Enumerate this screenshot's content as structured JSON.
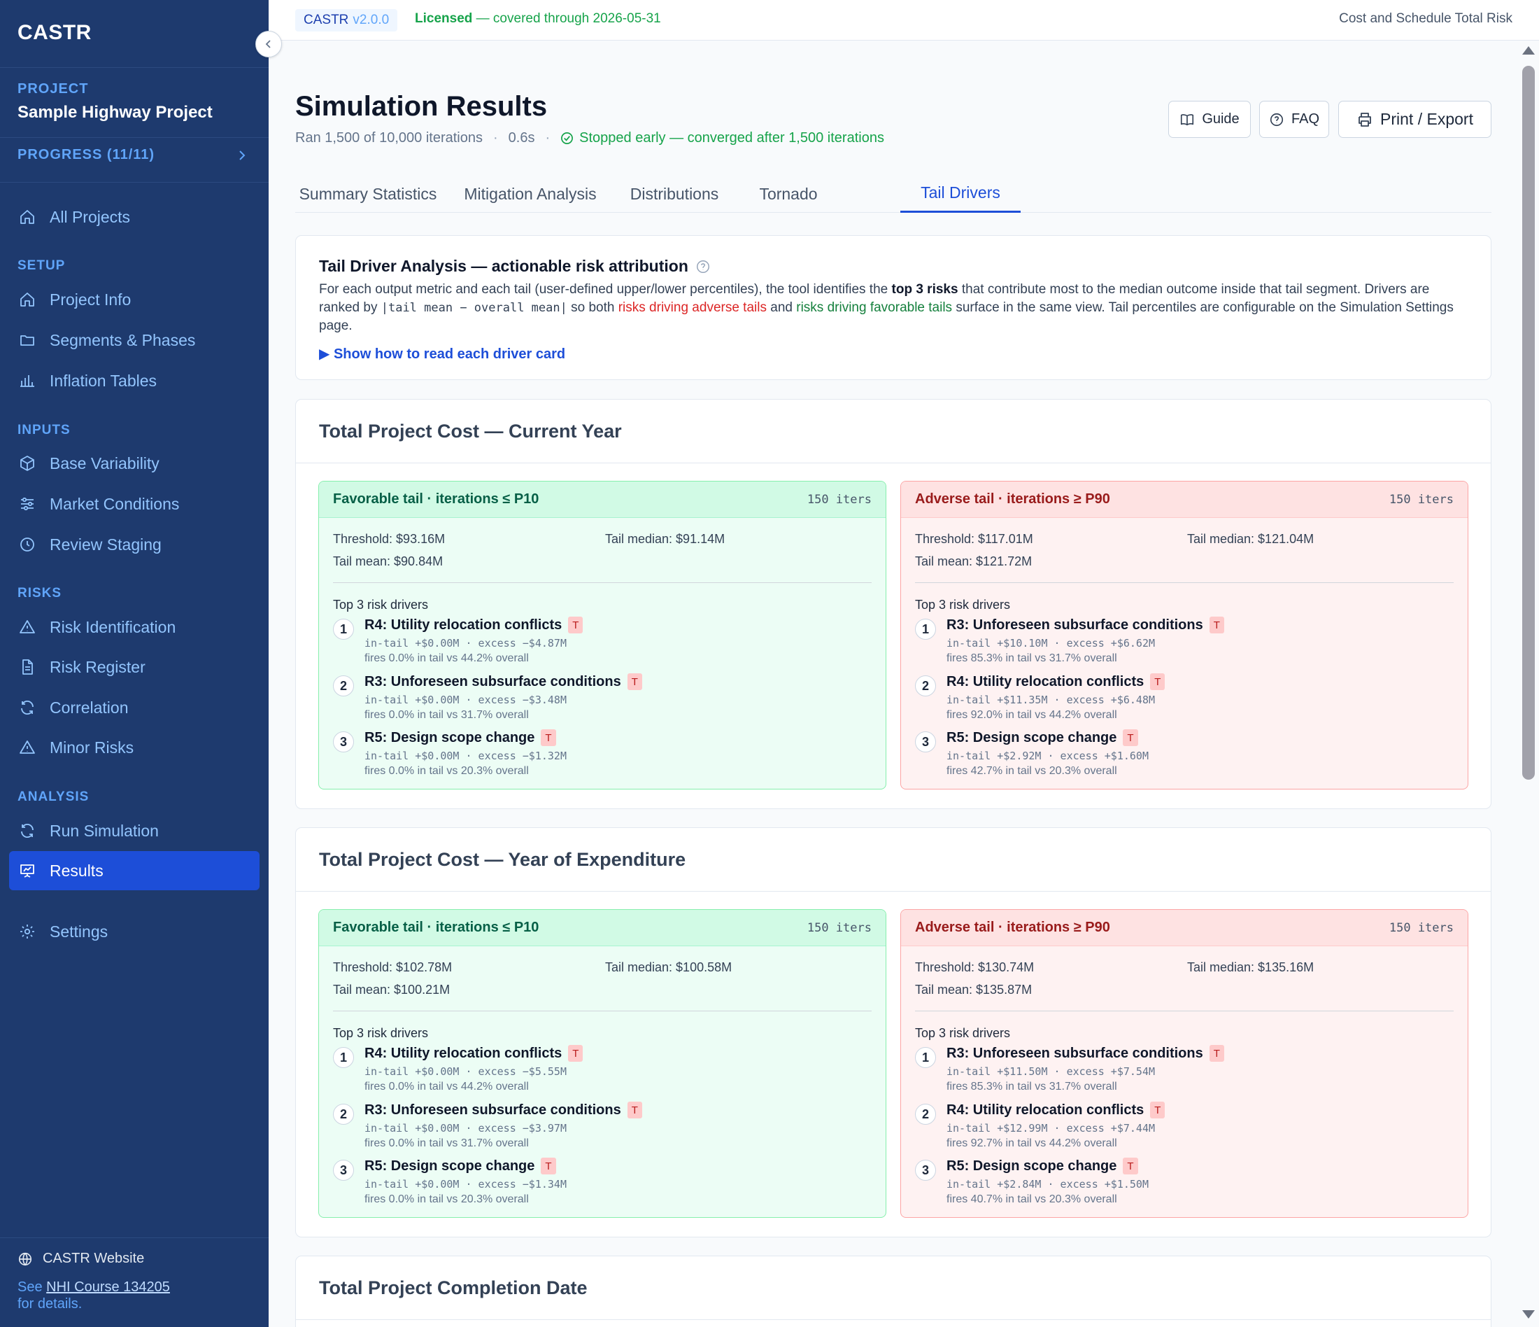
{
  "app": {
    "brand": "CASTR",
    "version_name": "CASTR",
    "version": "v2.0.0",
    "license_status": "Licensed",
    "license_detail": "— covered through 2026-05-31",
    "header_right": "Cost and Schedule Total Risk"
  },
  "sidebar": {
    "project_label": "PROJECT",
    "project_name": "Sample Highway Project",
    "progress": "PROGRESS (11/11)",
    "all_projects": "All Projects",
    "sections": {
      "setup": "SETUP",
      "inputs": "INPUTS",
      "risks": "RISKS",
      "analysis": "ANALYSIS"
    },
    "items": {
      "project_info": "Project Info",
      "segments_phases": "Segments & Phases",
      "inflation_tables": "Inflation Tables",
      "base_variability": "Base Variability",
      "market_conditions": "Market Conditions",
      "review_staging": "Review Staging",
      "risk_identification": "Risk Identification",
      "risk_register": "Risk Register",
      "correlation": "Correlation",
      "minor_risks": "Minor Risks",
      "run_simulation": "Run Simulation",
      "results": "Results",
      "settings": "Settings"
    },
    "footer": {
      "website": "CASTR Website",
      "see": "See",
      "course_link": "NHI Course 134205",
      "for_details": "for details."
    }
  },
  "page": {
    "title": "Simulation Results",
    "ran": "Ran 1,500 of 10,000 iterations",
    "dot": "·",
    "duration": "0.6s",
    "converged": "Stopped early — converged after 1,500 iterations",
    "buttons": {
      "guide": "Guide",
      "faq": "FAQ",
      "print": "Print / Export"
    },
    "tabs": [
      "Summary Statistics",
      "Mitigation Analysis",
      "Distributions",
      "Tornado",
      "Tail Drivers"
    ],
    "active_tab": "Tail Drivers"
  },
  "intro": {
    "title": "Tail Driver Analysis — actionable risk attribution",
    "p1": "For each output metric and each tail (user-defined upper/lower percentiles), the tool identifies the",
    "p1_bold": "top 3 risks",
    "p1_end": "that contribute most to the median outcome inside that tail segment.",
    "p2_start": "Drivers are ranked by",
    "p2_code": "|tail mean − overall mean|",
    "p2_mid": "so both",
    "p2_red": "risks driving adverse tails",
    "p2_and": "and",
    "p2_green": "risks driving favorable tails",
    "p2_end": "surface in the same view. Tail percentiles are configurable on the Simulation Settings page.",
    "link": "▶ Show how to read each driver card"
  },
  "sections": [
    {
      "title": "Total Project Cost — Current Year",
      "favorable": {
        "label": "Favorable tail · iterations ≤ P10",
        "iters": "150 iters",
        "threshold": "Threshold: $93.16M",
        "median": "Tail median: $91.14M",
        "mean": "Tail mean: $90.84M",
        "drivers_heading": "Top 3 risk drivers",
        "drivers": [
          {
            "rank": "1",
            "name": "R4: Utility relocation conflicts",
            "tag": "T",
            "line": "in-tail +$0.00M · excess −$4.87M",
            "fires": "fires 0.0% in tail vs 44.2% overall"
          },
          {
            "rank": "2",
            "name": "R3: Unforeseen subsurface conditions",
            "tag": "T",
            "line": "in-tail +$0.00M · excess −$3.48M",
            "fires": "fires 0.0% in tail vs 31.7% overall"
          },
          {
            "rank": "3",
            "name": "R5: Design scope change",
            "tag": "T",
            "line": "in-tail +$0.00M · excess −$1.32M",
            "fires": "fires 0.0% in tail vs 20.3% overall"
          }
        ]
      },
      "adverse": {
        "label": "Adverse tail · iterations ≥ P90",
        "iters": "150 iters",
        "threshold": "Threshold: $117.01M",
        "median": "Tail median: $121.04M",
        "mean": "Tail mean: $121.72M",
        "drivers_heading": "Top 3 risk drivers",
        "drivers": [
          {
            "rank": "1",
            "name": "R3: Unforeseen subsurface conditions",
            "tag": "T",
            "line": "in-tail +$10.10M · excess +$6.62M",
            "fires": "fires 85.3% in tail vs 31.7% overall"
          },
          {
            "rank": "2",
            "name": "R4: Utility relocation conflicts",
            "tag": "T",
            "line": "in-tail +$11.35M · excess +$6.48M",
            "fires": "fires 92.0% in tail vs 44.2% overall"
          },
          {
            "rank": "3",
            "name": "R5: Design scope change",
            "tag": "T",
            "line": "in-tail +$2.92M · excess +$1.60M",
            "fires": "fires 42.7% in tail vs 20.3% overall"
          }
        ]
      }
    },
    {
      "title": "Total Project Cost — Year of Expenditure",
      "favorable": {
        "label": "Favorable tail · iterations ≤ P10",
        "iters": "150 iters",
        "threshold": "Threshold: $102.78M",
        "median": "Tail median: $100.58M",
        "mean": "Tail mean: $100.21M",
        "drivers_heading": "Top 3 risk drivers",
        "drivers": [
          {
            "rank": "1",
            "name": "R4: Utility relocation conflicts",
            "tag": "T",
            "line": "in-tail +$0.00M · excess −$5.55M",
            "fires": "fires 0.0% in tail vs 44.2% overall"
          },
          {
            "rank": "2",
            "name": "R3: Unforeseen subsurface conditions",
            "tag": "T",
            "line": "in-tail +$0.00M · excess −$3.97M",
            "fires": "fires 0.0% in tail vs 31.7% overall"
          },
          {
            "rank": "3",
            "name": "R5: Design scope change",
            "tag": "T",
            "line": "in-tail +$0.00M · excess −$1.34M",
            "fires": "fires 0.0% in tail vs 20.3% overall"
          }
        ]
      },
      "adverse": {
        "label": "Adverse tail · iterations ≥ P90",
        "iters": "150 iters",
        "threshold": "Threshold: $130.74M",
        "median": "Tail median: $135.16M",
        "mean": "Tail mean: $135.87M",
        "drivers_heading": "Top 3 risk drivers",
        "drivers": [
          {
            "rank": "1",
            "name": "R3: Unforeseen subsurface conditions",
            "tag": "T",
            "line": "in-tail +$11.50M · excess +$7.54M",
            "fires": "fires 85.3% in tail vs 31.7% overall"
          },
          {
            "rank": "2",
            "name": "R4: Utility relocation conflicts",
            "tag": "T",
            "line": "in-tail +$12.99M · excess +$7.44M",
            "fires": "fires 92.7% in tail vs 44.2% overall"
          },
          {
            "rank": "3",
            "name": "R5: Design scope change",
            "tag": "T",
            "line": "in-tail +$2.84M · excess +$1.50M",
            "fires": "fires 40.7% in tail vs 20.3% overall"
          }
        ]
      }
    },
    {
      "title": "Total Project Completion Date"
    }
  ],
  "colors": {
    "sidebar_bg": "#1e3a6e",
    "accent": "#1d4ed8",
    "favorable_bg": "#ecfdf5",
    "adverse_bg": "#fef2f2",
    "success": "#16a34a",
    "danger": "#dc2626"
  }
}
